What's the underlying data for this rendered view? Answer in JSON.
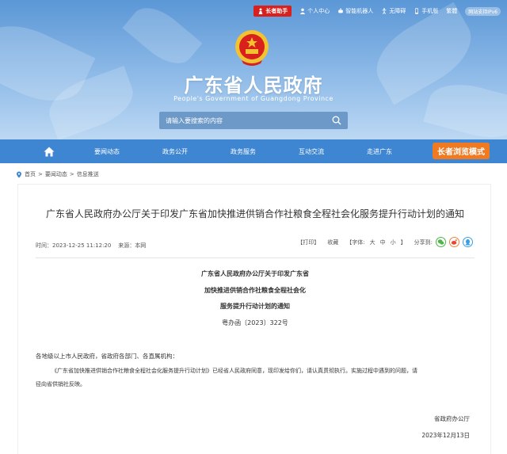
{
  "topbar": {
    "elder_label": "长者助手",
    "personal_center": "个人中心",
    "robot": "智能机器人",
    "accessibility": "无障碍",
    "mobile": "手机版",
    "traditional": "繁體",
    "ipv6": "网站支持IPv6"
  },
  "site": {
    "title": "广东省人民政府",
    "subtitle": "People's Government of Guangdong Province"
  },
  "search": {
    "placeholder": "请输入要搜索的内容"
  },
  "nav": {
    "items": [
      "要闻动态",
      "政务公开",
      "政务服务",
      "互动交流",
      "走进广东"
    ],
    "elder_mode": "长者浏览模式"
  },
  "breadcrumb": [
    "首页",
    "要闻动态",
    "信息推送"
  ],
  "article": {
    "title": "广东省人民政府办公厅关于印发广东省加快推进供销合作社粮食全程社会化服务提升行动计划的通知",
    "time_label": "时间：2023-12-25 11:12:20",
    "source_label": "来源：本网",
    "print": "【打印】",
    "favorite": "收藏",
    "font_label": "【字体:",
    "font_sizes": [
      "大",
      "中",
      "小"
    ],
    "font_close": "】",
    "share_label": "分享到:",
    "doc_title_lines": [
      "广东省人民政府办公厅关于印发广东省",
      "加快推进供销合作社粮食全程社会化",
      "服务提升行动计划的通知"
    ],
    "doc_no": "粤办函〔2023〕322号",
    "recipients": "各地级以上市人民政府，省政府各部门、各直属机构：",
    "body_line1": "《广东省加快推进供销合作社粮食全程社会化服务提升行动计划》已经省人民政府同意，现印发给你们，请认真贯彻执行。实施过程中遇到的问题，请",
    "body_line2": "径向省供销社反映。",
    "signer": "省政府办公厅",
    "date": "2023年12月13日"
  },
  "colors": {
    "nav_blue": "#3e86d1",
    "elder_red": "#d8201c",
    "elder_mode_orange": "#f07a22",
    "share_wechat": "#4cb648",
    "share_weibo": "#f0833a",
    "share_qq": "#3a9ee8"
  }
}
